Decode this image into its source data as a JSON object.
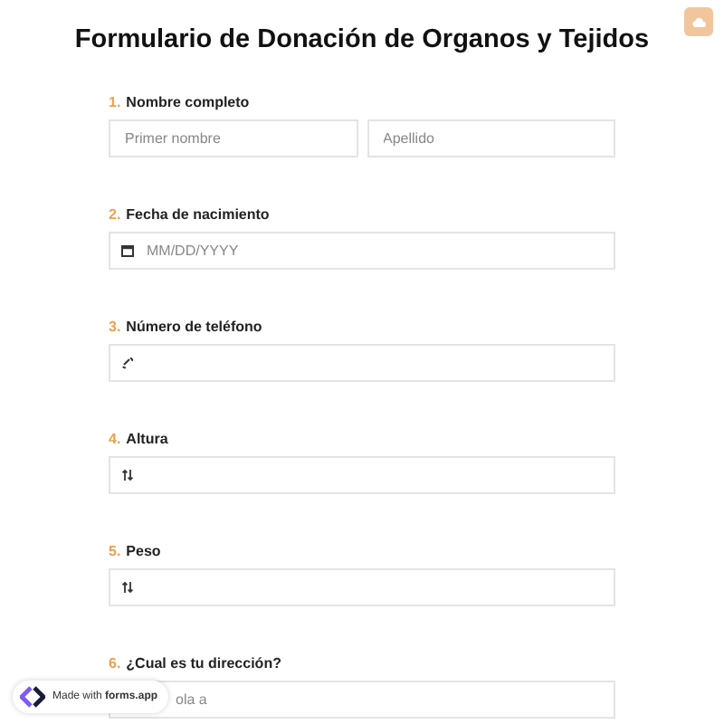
{
  "title": "Formulario de Donación de Organos y Tejidos",
  "questions": [
    {
      "number": "1.",
      "label": "Nombre completo",
      "kind": "name",
      "fields": [
        {
          "placeholder": "Primer nombre"
        },
        {
          "placeholder": "Apellido"
        }
      ]
    },
    {
      "number": "2.",
      "label": "Fecha de nacimiento",
      "kind": "date",
      "fields": [
        {
          "placeholder": "MM/DD/YYYY"
        }
      ]
    },
    {
      "number": "3.",
      "label": "Número de teléfono",
      "kind": "phone"
    },
    {
      "number": "4.",
      "label": "Altura",
      "kind": "number"
    },
    {
      "number": "5.",
      "label": "Peso",
      "kind": "number"
    },
    {
      "number": "6.",
      "label": "¿Cual es tu dirección?",
      "kind": "address",
      "fields": [
        {
          "placeholder": "ola a"
        }
      ]
    }
  ],
  "badge": {
    "prefix": "Made with",
    "brand": "forms.app"
  }
}
